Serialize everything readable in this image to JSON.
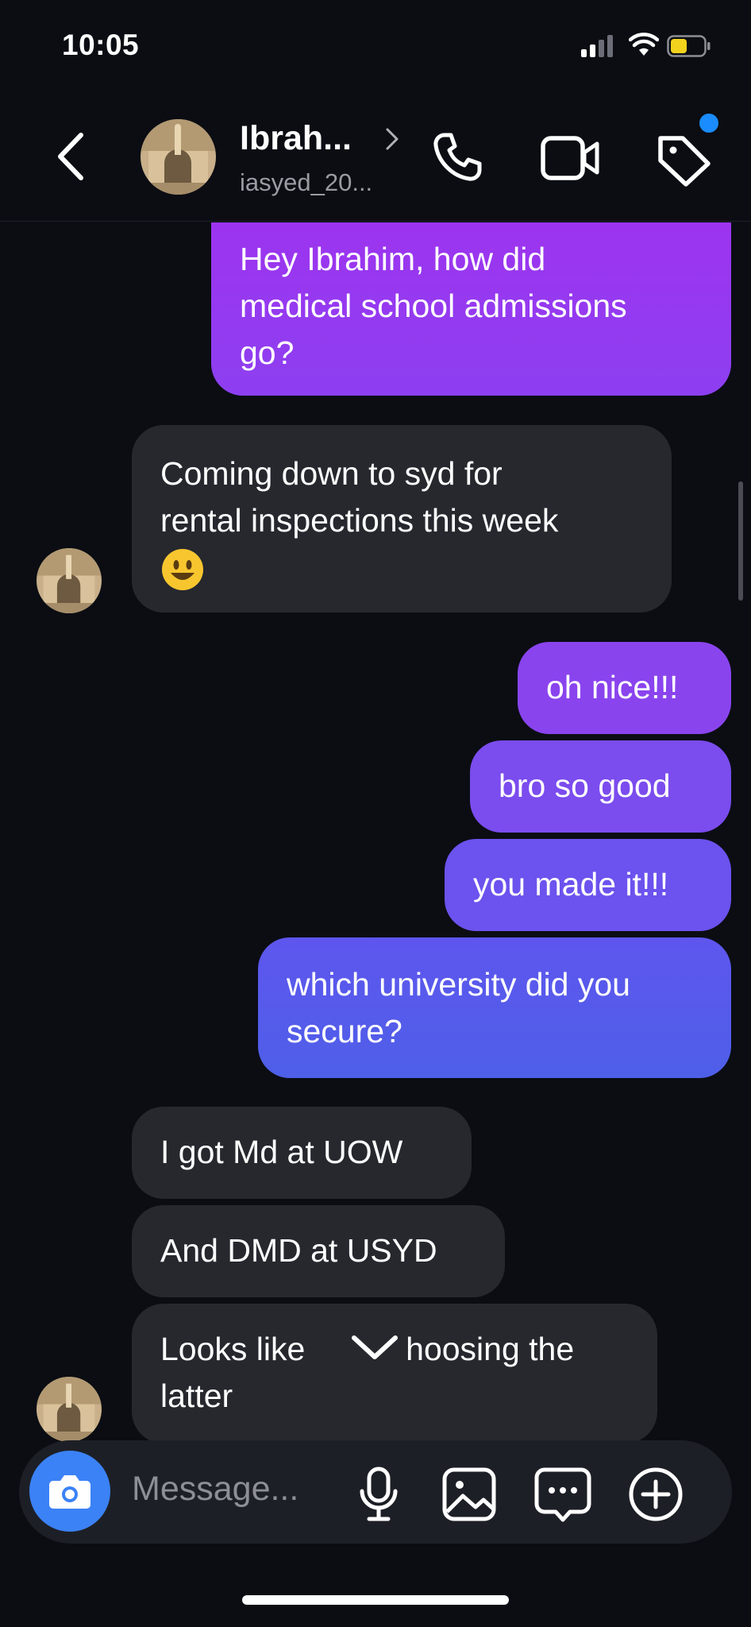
{
  "status_bar": {
    "time": "10:05"
  },
  "header": {
    "contact_name": "Ibrah...",
    "username": "iasyed_20...",
    "back_icon": "chevron-left-icon",
    "call_icon": "phone-icon",
    "video_icon": "video-camera-icon",
    "tag_icon": "tag-icon",
    "notification_dot_color": "#1a8cff"
  },
  "messages": [
    {
      "direction": "sent",
      "text": "Hey Ibrahim, how did\nmedical school admissions\ngo?"
    },
    {
      "direction": "received",
      "text": "Coming down to syd for\nrental inspections this week",
      "emoji": "smiling-face-emoji"
    },
    {
      "direction": "sent",
      "text": "oh nice!!!"
    },
    {
      "direction": "sent",
      "text": "bro so good"
    },
    {
      "direction": "sent",
      "text": "you made it!!!"
    },
    {
      "direction": "sent",
      "text": "which university did you\nsecure?"
    },
    {
      "direction": "received",
      "text": "I got Md at UOW"
    },
    {
      "direction": "received",
      "text": "And DMD at USYD"
    },
    {
      "direction": "received",
      "text_line1_start": "Looks like",
      "text_line1_end": "hoosing the",
      "text_line2": "latter"
    }
  ],
  "composer": {
    "placeholder": "Message...",
    "camera_icon": "camera-icon",
    "mic_icon": "microphone-icon",
    "gallery_icon": "image-icon",
    "sticker_icon": "sticker-chat-icon",
    "plus_icon": "plus-circle-icon",
    "camera_button_color": "#3b82f6"
  },
  "colors": {
    "background": "#0b0d13",
    "received_bubble": "#26282e",
    "sent_gradient_top": "#a031f0",
    "sent_gradient_bottom": "#4f5ce8"
  }
}
